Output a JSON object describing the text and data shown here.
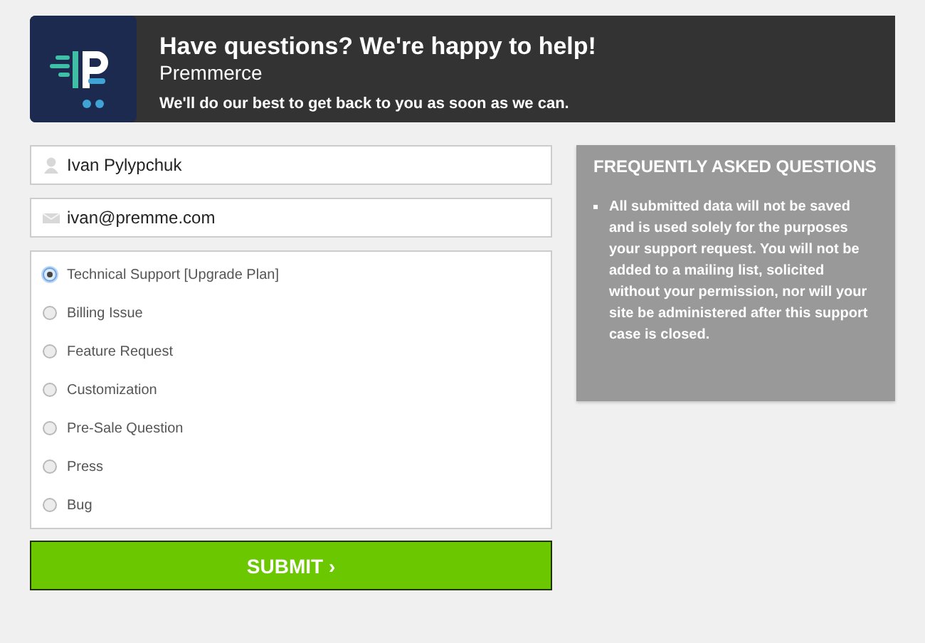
{
  "header": {
    "title": "Have questions? We're happy to help!",
    "brand": "Premmerce",
    "subtitle": "We'll do our best to get back to you as soon as we can."
  },
  "fields": [
    {
      "kind": "name",
      "value": "Ivan Pylypchuk"
    },
    {
      "kind": "email",
      "value": "ivan@premme.com"
    }
  ],
  "topics": [
    {
      "label": "Technical Support [Upgrade Plan]",
      "selected": true
    },
    {
      "label": "Billing Issue",
      "selected": false
    },
    {
      "label": "Feature Request",
      "selected": false
    },
    {
      "label": "Customization",
      "selected": false
    },
    {
      "label": "Pre-Sale Question",
      "selected": false
    },
    {
      "label": "Press",
      "selected": false
    },
    {
      "label": "Bug",
      "selected": false
    }
  ],
  "submit_button": "SUBMIT ›",
  "faq": {
    "title": "FREQUENTLY ASKED QUESTIONS",
    "items": [
      "All submitted data will not be saved and is used solely for the purposes your support request. You will not be added to a mailing list, solicited without your permission, nor will your site be administered after this support case is closed."
    ]
  }
}
